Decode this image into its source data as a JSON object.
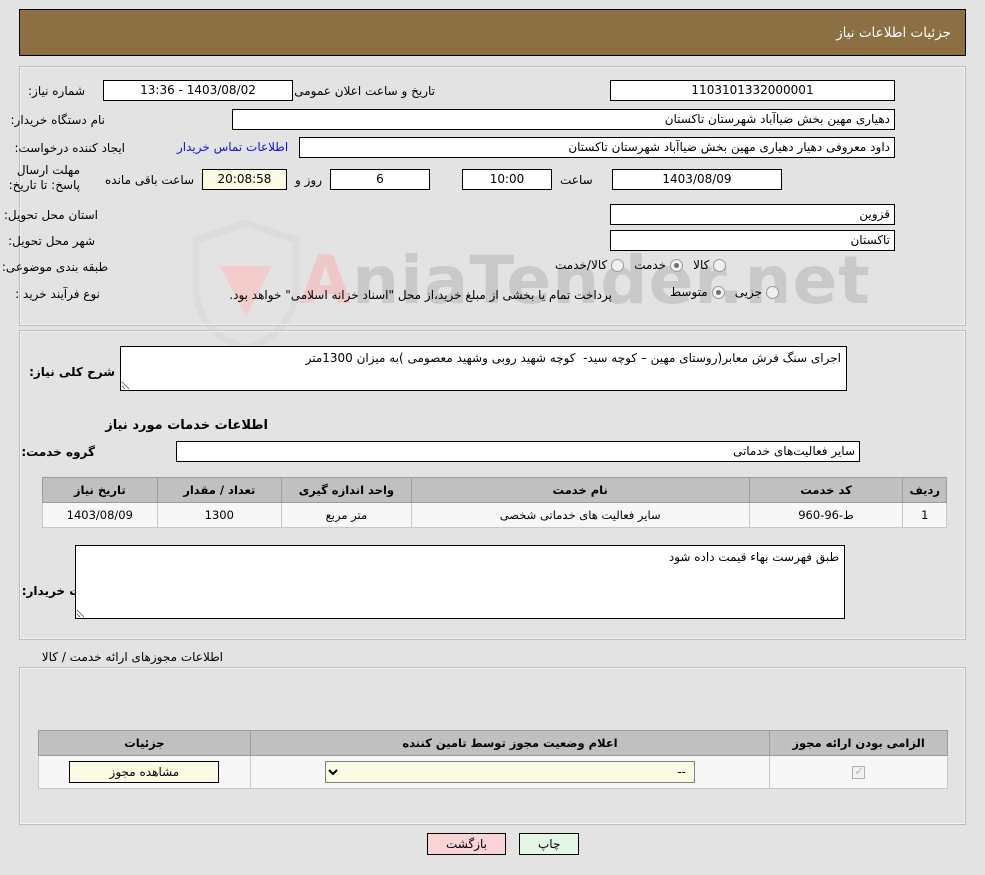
{
  "header": {
    "title": "جزئیات اطلاعات نیاز",
    "bar_color": "#8c6f42"
  },
  "watermark": {
    "text_left": "Ania",
    "text_right": "Tender.net"
  },
  "top_form": {
    "need_number_label": "شماره نیاز:",
    "need_number_value": "1103101332000001",
    "announce_datetime_label": "تاریخ و ساعت اعلان عمومی:",
    "announce_datetime_value": "1403/08/02 - 13:36",
    "buyer_org_label": "نام دستگاه خریدار:",
    "buyer_org_value": "دهیاری مهین بخش ضیاآباد شهرستان تاکستان",
    "requester_label": "ایجاد کننده درخواست:",
    "requester_value": "داود معروفی دهیار دهیاری مهین بخش ضیاآباد شهرستان تاکستان",
    "contact_link": "اطلاعات تماس خریدار",
    "deadline_label": "مهلت ارسال پاسخ: تا تاریخ:",
    "deadline_date": "1403/08/09",
    "hour_label": "ساعت",
    "hour_value": "10:00",
    "days_value": "6",
    "days_label": "روز و",
    "timer_value": "20:08:58",
    "remaining_label": "ساعت باقی مانده",
    "province_label": "استان محل تحویل:",
    "province_value": "قزوین",
    "city_label": "شهر محل تحویل:",
    "city_value": "تاکستان",
    "category_label": "طبقه بندی موضوعی:",
    "category_options": [
      {
        "label": "کالا",
        "selected": false
      },
      {
        "label": "خدمت",
        "selected": true
      },
      {
        "label": "کالا/خدمت",
        "selected": false
      }
    ],
    "process_label": "نوع فرآیند خرید :",
    "process_options": [
      {
        "label": "جزیی",
        "selected": false
      },
      {
        "label": "متوسط",
        "selected": true
      }
    ],
    "treasury_checkbox_checked": false,
    "treasury_text": "پرداخت تمام یا بخشی از مبلغ خرید،از محل \"اسناد خزانه اسلامی\" خواهد بود."
  },
  "mid_section": {
    "need_desc_label": "شرح کلی نیاز:",
    "need_desc_value": "اجرای سنگ فرش معابر(روستای مهین – کوچه سید-  کوچه شهید روبی وشهید معصومی )به میزان 1300متر",
    "services_heading": "اطلاعات خدمات مورد نیاز",
    "service_group_label": "گروه خدمت:",
    "service_group_value": "سایر فعالیت‌های خدماتی",
    "table_headers": [
      "ردیف",
      "کد خدمت",
      "نام خدمت",
      "واحد اندازه گیری",
      "تعداد / مقدار",
      "تاریخ نیاز"
    ],
    "table_rows": [
      {
        "row": "1",
        "service_code": "ط-96-960",
        "service_name": "سایر فعالیت های خدماتی شخصی",
        "unit": "متر مربع",
        "quantity": "1300",
        "need_date": "1403/08/09"
      }
    ],
    "buyer_notes_label": "توضیحات خریدار:",
    "buyer_notes_value": "طبق فهرست بهاء قیمت داده شود"
  },
  "permits_section": {
    "heading": "اطلاعات مجوزهای ارائه خدمت / کالا",
    "table_headers": [
      "الزامی بودن ارائه مجوز",
      "اعلام وضعیت مجوز توسط تامین کننده",
      "جزئیات"
    ],
    "required_checked": true,
    "status_selected": "--",
    "status_options": [
      "--"
    ],
    "details_button": "مشاهده مجوز"
  },
  "footer": {
    "print_button": "چاپ",
    "back_button": "بازگشت"
  }
}
